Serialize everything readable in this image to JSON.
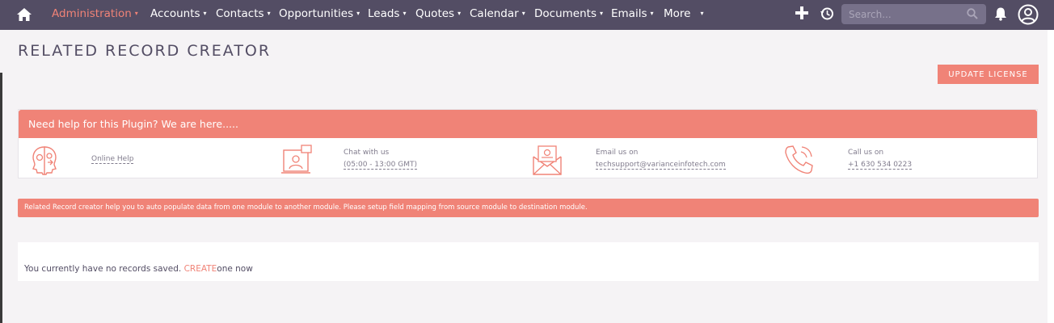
{
  "nav": {
    "items": [
      {
        "label": "Administration",
        "active": true
      },
      {
        "label": "Accounts"
      },
      {
        "label": "Contacts"
      },
      {
        "label": "Opportunities"
      },
      {
        "label": "Leads"
      },
      {
        "label": "Quotes"
      },
      {
        "label": "Calendar"
      },
      {
        "label": "Documents"
      },
      {
        "label": "Emails"
      },
      {
        "label": "More"
      }
    ],
    "caret": "▾",
    "search_placeholder": "Search...",
    "icons": [
      "home-icon",
      "plus-icon",
      "history-icon",
      "search-icon",
      "bell-icon",
      "user-avatar-icon"
    ]
  },
  "page": {
    "title": "RELATED RECORD CREATOR",
    "update_license_label": "UPDATE LICENSE"
  },
  "help": {
    "heading": "Need help for this Plugin? We are here.....",
    "online_help": "Online Help",
    "chat_label": "Chat with us",
    "chat_hours": "(05:00 - 13:00 GMT)",
    "email_label": "Email us on",
    "email_value": "techsupport@varianceinfotech.com",
    "call_label": "Call us on",
    "call_value": "+1 630 534 0223"
  },
  "info_text": "Related Record creator help you to auto populate data from one module to another module. Please setup field mapping from source module to destination module.",
  "records": {
    "empty_prefix": "You currently have no records saved. ",
    "create_link": "CREATE",
    "empty_suffix": "one now"
  },
  "colors": {
    "nav_bg": "#534d64",
    "accent": "#f08377",
    "page_bg": "#f5f3f5"
  }
}
